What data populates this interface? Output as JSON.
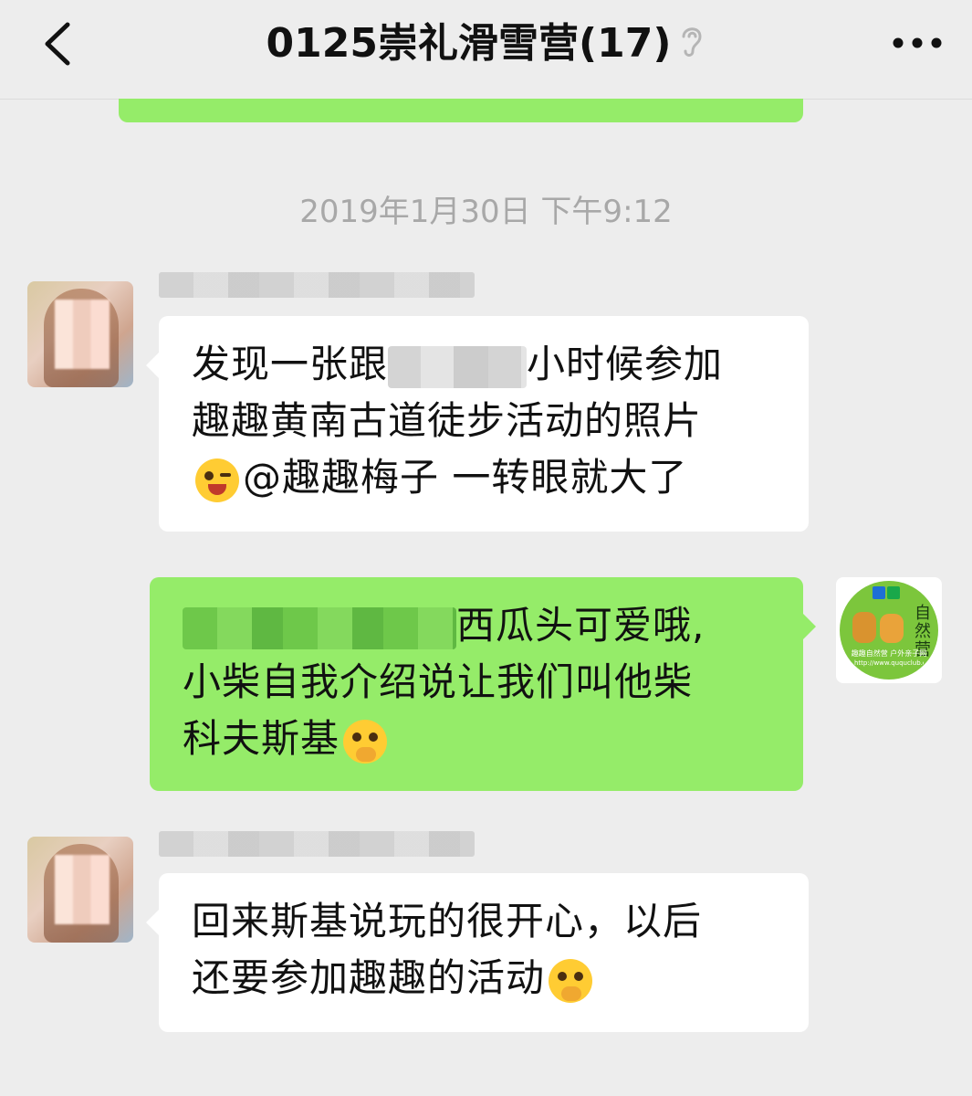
{
  "header": {
    "title": "0125崇礼滑雪营(17)",
    "back_icon": "chevron-left-icon",
    "more_icon": "more-dots-icon",
    "mute_icon": "ear-icon"
  },
  "timestamp": "2019年1月30日 下午9:12",
  "messages": [
    {
      "side": "left",
      "line1_pre": "发现一张跟",
      "line1_post": "小时候参加",
      "line2": "趣趣黄南古道徒步活动的照片",
      "line3_mention": "@趣趣梅子",
      "line3_rest": " 一转眼就大了",
      "emoji": "winking-tongue-emoji"
    },
    {
      "side": "right",
      "line1_post": "西瓜头可爱哦,",
      "line2": "小柴自我介绍说让我们叫他柴",
      "line3": "科夫斯基",
      "emoji": "face-with-hand-over-mouth-emoji"
    },
    {
      "side": "left",
      "line1": "回来斯基说玩的很开心，以后",
      "line2": "还要参加趣趣的活动",
      "emoji": "face-with-hand-over-mouth-emoji"
    }
  ],
  "logo": {
    "text": "自然营",
    "band1": "趣趣自然营 户外亲子网",
    "band2": "http://www.ququclub.com"
  },
  "colors": {
    "background": "#ededed",
    "green_bubble": "#95ec69",
    "white_bubble": "#ffffff",
    "timestamp": "#a8a8a8"
  }
}
